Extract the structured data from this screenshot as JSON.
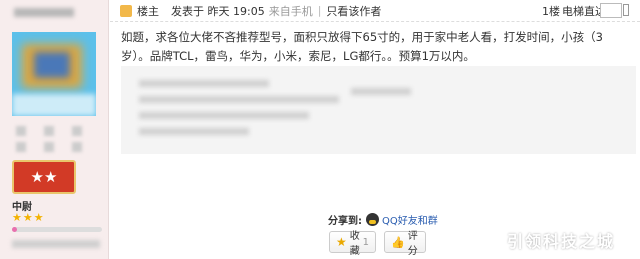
{
  "profile": {
    "rank_badge_stars": "★★",
    "rank_name": "中尉",
    "rank_stars": "★★★",
    "progress_fraction": 0.06
  },
  "post_header": {
    "op_label": "楼主",
    "time_text": "发表于 昨天 19:05",
    "device_text": "来自手机",
    "separator": "|",
    "only_op": "只看该作者",
    "floor": "1楼",
    "direct": "电梯直达"
  },
  "post": {
    "content": "如题，求各位大佬不吝推荐型号，面积只放得下65寸的，用于家中老人看，打发时间，小孩（3岁）。品牌TCL，雷鸟，华为，小米，索尼，LG都行。。预算1万以内。"
  },
  "share": {
    "label": "分享到:",
    "qq_text": "QQ好友和群"
  },
  "actions": {
    "favorite_label": "收藏",
    "favorite_count": "1",
    "rate_label": "评分"
  },
  "watermark": "引领科技之城",
  "colors": {
    "sidebar_bg": "#f7eded",
    "rank_badge": "#d23a26",
    "link": "#2a5db0"
  }
}
